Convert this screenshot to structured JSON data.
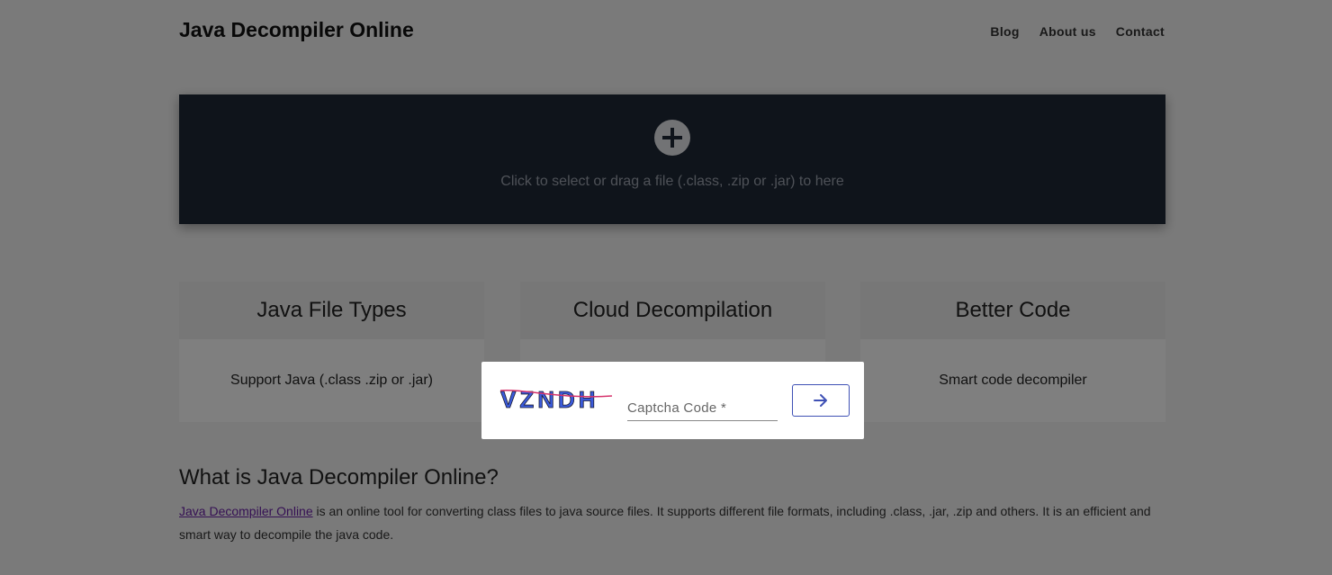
{
  "header": {
    "brand": "Java Decompiler Online",
    "nav": [
      "Blog",
      "About us",
      "Contact"
    ]
  },
  "dropzone": {
    "icon": "plus-circle-icon",
    "text": "Click to select or drag a file (.class, .zip or .jar) to here"
  },
  "features": [
    {
      "title": "Java File Types",
      "text": "Support Java (.class .zip or .jar)"
    },
    {
      "title": "Cloud Decompilation",
      "text": ""
    },
    {
      "title": "Better Code",
      "text": "Smart code decompiler"
    }
  ],
  "about": {
    "title": "What is Java Decompiler Online?",
    "link_text": "Java Decompiler Online",
    "text": " is an online tool for converting class files to java source files. It supports different file formats, including .class, .jar, .zip and others. It is an efficient and smart way to decompile the java code."
  },
  "captcha": {
    "code_text": "VZNDH",
    "placeholder": "Captcha Code *",
    "submit_icon": "arrow-right-icon"
  },
  "colors": {
    "dropzone_bg": "#1f2937",
    "accent": "#3f51b5",
    "overlay": "rgba(0,0,0,0.5)"
  }
}
